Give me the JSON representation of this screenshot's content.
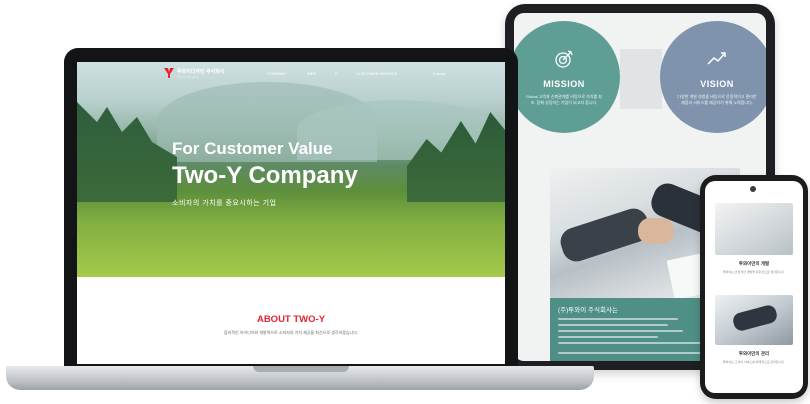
{
  "tablet": {
    "mission": {
      "title": "MISSION",
      "desc": "Global 고객과 신뢰관계를 바탕으로 가치를 창조, 함께 성장하는 기업이 되고자 합니다."
    },
    "vision": {
      "title": "VISION",
      "desc": "다양한 개발 경험을 바탕으로 안정적이고 편리한 제품과 서비스를 제공하기 위해 노력합니다."
    },
    "section_title": "(주)투와이 주식회사는",
    "colors": {
      "mission": "#5f9e95",
      "vision": "#7f93ad",
      "teal": "#4f8f86"
    },
    "icons": [
      "target-icon",
      "chart-up-icon"
    ]
  },
  "laptop": {
    "nav": {
      "logo_text": "투와이디자인 주식회사",
      "logo_sub": "Two-Y Company",
      "items": [
        "COMPANY",
        "WEB",
        "IT",
        "CUSTOMER SERVICE",
        "Korean"
      ]
    },
    "hero": {
      "line1": "For Customer Value",
      "line2": "Two-Y Company",
      "sub": "소비자의 가치를 중요시하는 기업"
    },
    "about": {
      "title": "ABOUT TWO-Y",
      "desc": "합리적인 아이디어와 개발력으로 소비자의 가치 제공을 최선으로 생각하겠습니다."
    },
    "colors": {
      "accent": "#e0262f"
    }
  },
  "phone": {
    "section1_title": "투와이만의 개발",
    "section1_text": "투와이는 안정적인 개발을 최우선으로 생각합니다.",
    "section2_title": "투와이만의 관리",
    "section2_text": "투와이는 고객의 서비스를 체계적으로 관리합니다."
  }
}
